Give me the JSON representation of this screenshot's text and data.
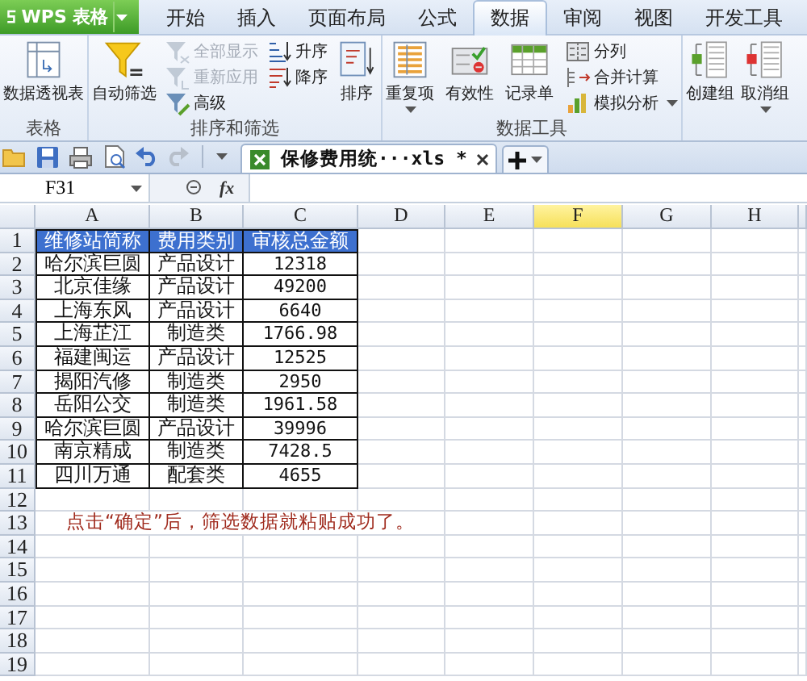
{
  "app_button": {
    "label": "WPS 表格"
  },
  "tabs": [
    {
      "label": "开始",
      "selected": false
    },
    {
      "label": "插入",
      "selected": false
    },
    {
      "label": "页面布局",
      "selected": false
    },
    {
      "label": "公式",
      "selected": false
    },
    {
      "label": "数据",
      "selected": true
    },
    {
      "label": "审阅",
      "selected": false
    },
    {
      "label": "视图",
      "selected": false
    },
    {
      "label": "开发工具",
      "selected": false
    }
  ],
  "ribbon": {
    "groups": [
      {
        "label": "表格",
        "columns": [
          [
            {
              "label": "数据透视表",
              "kind": "large",
              "disabled": false,
              "dropdown": false
            }
          ]
        ]
      },
      {
        "label": "排序和筛选",
        "columns": [
          [
            {
              "label": "自动筛选",
              "kind": "large",
              "disabled": false,
              "dropdown": false
            }
          ],
          [
            {
              "label": "全部显示",
              "kind": "small",
              "disabled": true,
              "dropdown": false
            },
            {
              "label": "重新应用",
              "kind": "small",
              "disabled": true,
              "dropdown": false
            },
            {
              "label": "高级",
              "kind": "small",
              "disabled": false,
              "dropdown": false
            }
          ],
          [
            {
              "label": "升序",
              "kind": "small",
              "disabled": false,
              "dropdown": false
            },
            {
              "label": "降序",
              "kind": "small",
              "disabled": false,
              "dropdown": false
            }
          ],
          [
            {
              "label": "排序",
              "kind": "large",
              "disabled": false,
              "dropdown": false
            }
          ]
        ]
      },
      {
        "label": "数据工具",
        "columns": [
          [
            {
              "label": "重复项",
              "kind": "large",
              "disabled": false,
              "dropdown": true
            }
          ],
          [
            {
              "label": "有效性",
              "kind": "large",
              "disabled": false,
              "dropdown": false
            }
          ],
          [
            {
              "label": "记录单",
              "kind": "large",
              "disabled": false,
              "dropdown": false
            }
          ],
          [
            {
              "label": "分列",
              "kind": "small",
              "disabled": false,
              "dropdown": false
            },
            {
              "label": "合并计算",
              "kind": "small",
              "disabled": false,
              "dropdown": false
            },
            {
              "label": "模拟分析",
              "kind": "small",
              "disabled": false,
              "dropdown": true
            }
          ]
        ]
      },
      {
        "columns": [
          [
            {
              "label": "创建组",
              "kind": "large",
              "disabled": false,
              "dropdown": false
            }
          ],
          [
            {
              "label": "取消组",
              "kind": "large",
              "disabled": false,
              "dropdown": true
            }
          ]
        ]
      }
    ]
  },
  "doc_tabs": [
    {
      "label": "保修费用统···xls *",
      "selected": true
    }
  ],
  "formula_bar": {
    "name_box": "F31",
    "function_label": "fx"
  },
  "sheet": {
    "columns": [
      {
        "label": "A",
        "selected": false
      },
      {
        "label": "B",
        "selected": false
      },
      {
        "label": "C",
        "selected": false
      },
      {
        "label": "D",
        "selected": false
      },
      {
        "label": "E",
        "selected": false
      },
      {
        "label": "F",
        "selected": true
      },
      {
        "label": "G",
        "selected": false
      },
      {
        "label": "H",
        "selected": false
      }
    ],
    "rows": [
      {
        "label": "1",
        "kind": "header",
        "cells": [
          "维修站简称",
          "费用类别",
          "审核总金额"
        ]
      },
      {
        "label": "2",
        "kind": "data",
        "cells": [
          "哈尔滨巨圆",
          "产品设计",
          "12318"
        ]
      },
      {
        "label": "3",
        "kind": "data",
        "cells": [
          "北京佳缘",
          "产品设计",
          "49200"
        ]
      },
      {
        "label": "4",
        "kind": "data",
        "cells": [
          "上海东风",
          "产品设计",
          "6640"
        ]
      },
      {
        "label": "5",
        "kind": "data",
        "cells": [
          "上海芷江",
          "制造类",
          "1766.98"
        ]
      },
      {
        "label": "6",
        "kind": "data",
        "cells": [
          "福建闽运",
          "产品设计",
          "12525"
        ]
      },
      {
        "label": "7",
        "kind": "data",
        "cells": [
          "揭阳汽修",
          "制造类",
          "2950"
        ]
      },
      {
        "label": "8",
        "kind": "data",
        "cells": [
          "岳阳公交",
          "制造类",
          "1961.58"
        ]
      },
      {
        "label": "9",
        "kind": "data",
        "cells": [
          "哈尔滨巨圆",
          "产品设计",
          "39996"
        ]
      },
      {
        "label": "10",
        "kind": "data",
        "cells": [
          "南京精成",
          "制造类",
          "7428.5"
        ]
      },
      {
        "label": "11",
        "kind": "data",
        "cells": [
          "四川万通",
          "配套类",
          "4655"
        ]
      },
      {
        "label": "12",
        "kind": "empty"
      },
      {
        "label": "13",
        "kind": "note",
        "text": "点击“确定”后，筛选数据就粘贴成功了。"
      },
      {
        "label": "14",
        "kind": "empty"
      },
      {
        "label": "15",
        "kind": "empty"
      },
      {
        "label": "16",
        "kind": "empty"
      },
      {
        "label": "17",
        "kind": "empty"
      },
      {
        "label": "18",
        "kind": "empty"
      },
      {
        "label": "19",
        "kind": "empty"
      }
    ]
  }
}
